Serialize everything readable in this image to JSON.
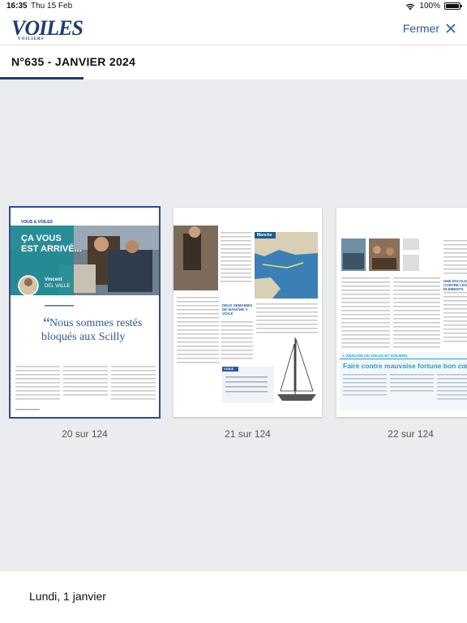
{
  "status_bar": {
    "time": "16:35",
    "date": "Thu 15 Feb",
    "battery": "100%",
    "battery_level": 1.0,
    "icons": [
      "wifi-icon",
      "battery-icon"
    ]
  },
  "header": {
    "logo": "VOILES",
    "logo_sub": "VOILIERS",
    "close_label": "Fermer",
    "close_icon": "close-icon",
    "accent": "#2a5b9b"
  },
  "issue": {
    "title": "N°635 - JANVIER 2024"
  },
  "pages": [
    {
      "label": "20 sur 124",
      "selected": true,
      "content": {
        "rubric": "VOUS & VOILES",
        "headline_1": "ÇA VOUS",
        "headline_2": "EST ARRIVÉ...",
        "author_first": "Vincent",
        "author_last": "DEL VALLE",
        "quote_1": "Nous sommes restés",
        "quote_2": "bloqués aux Scilly"
      }
    },
    {
      "label": "21 sur 124",
      "selected": false,
      "content": {
        "map_title": "Manche",
        "box_title": "DEUX SEMAINES DE MANCHE À VOILE",
        "specs_title": "VOILE"
      }
    },
    {
      "label": "22 sur 124",
      "selected": false,
      "content": {
        "section_label": "L'ANALYSE DE VOILES ET VOILIERS",
        "section_title": "Faire contre mauvaise fortune bon cœur",
        "side_heading": "UNE ESCALE CONTRE LES ÉLÉMENTS"
      }
    }
  ],
  "footer": {
    "date": "Lundi, 1 janvier"
  }
}
